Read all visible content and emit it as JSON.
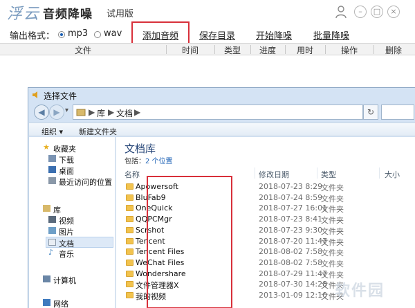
{
  "app": {
    "logo": "浮云",
    "name": "音频降噪",
    "edition": "试用版"
  },
  "window_buttons": {
    "minimize": "–",
    "maximize": "□",
    "close": "×"
  },
  "toolbar": {
    "format_label": "输出格式：",
    "format_options": [
      "mp3",
      "wav"
    ],
    "selected_format": "mp3",
    "add_audio": "添加音频",
    "save_dir": "保存目录",
    "start": "开始降噪",
    "batch": "批量降噪"
  },
  "table": {
    "columns": [
      "文件",
      "时间",
      "类型",
      "进度",
      "用时",
      "操作",
      "删除"
    ]
  },
  "dialog": {
    "title": "选择文件",
    "nav": {
      "back": "◀",
      "forward": "▶",
      "dropdown": "▾",
      "refresh": "↻"
    },
    "address": [
      "库",
      "▶",
      "文档",
      "▶"
    ],
    "commands": {
      "organize": "组织 ▾",
      "new_folder": "新建文件夹"
    },
    "tree": {
      "favorites": "收藏夹",
      "fav_items": [
        "下载",
        "桌面",
        "最近访问的位置"
      ],
      "libraries": "库",
      "lib_items": [
        "视频",
        "图片",
        "文档",
        "音乐"
      ],
      "computer": "计算机",
      "network": "网络"
    },
    "library": {
      "title": "文档库",
      "includes": "包括：",
      "locations": "2 个位置"
    },
    "columns": {
      "name": "名称",
      "modified": "修改日期",
      "type": "类型",
      "size": "大小"
    },
    "files": [
      {
        "name": "Apowersoft",
        "date": "2018-07-23 8:29",
        "type": "文件夹"
      },
      {
        "name": "BluFab9",
        "date": "2018-07-24 8:59",
        "type": "文件夹"
      },
      {
        "name": "OneQuick",
        "date": "2018-07-27 16:01",
        "type": "文件夹"
      },
      {
        "name": "QQPCMgr",
        "date": "2018-07-23 8:41",
        "type": "文件夹"
      },
      {
        "name": "Scrshot",
        "date": "2018-07-23 9:30",
        "type": "文件夹"
      },
      {
        "name": "Tencent",
        "date": "2018-07-20 11:47",
        "type": "文件夹"
      },
      {
        "name": "Tencent Files",
        "date": "2018-08-02 7:58",
        "type": "文件夹"
      },
      {
        "name": "WeChat Files",
        "date": "2018-08-02 7:58",
        "type": "文件夹"
      },
      {
        "name": "Wondershare",
        "date": "2018-07-29 11:47",
        "type": "文件夹"
      },
      {
        "name": "文件管理器X",
        "date": "2018-07-30 14:28",
        "type": "文件夹"
      },
      {
        "name": "我的视频",
        "date": "2013-01-09 12:10",
        "type": "文件夹"
      }
    ]
  },
  "watermark": "软件园",
  "colors": {
    "highlight_box": "#d8303a",
    "library_title": "#1e3f73",
    "link": "#1a5fb4",
    "folder": "#f2c34e"
  }
}
